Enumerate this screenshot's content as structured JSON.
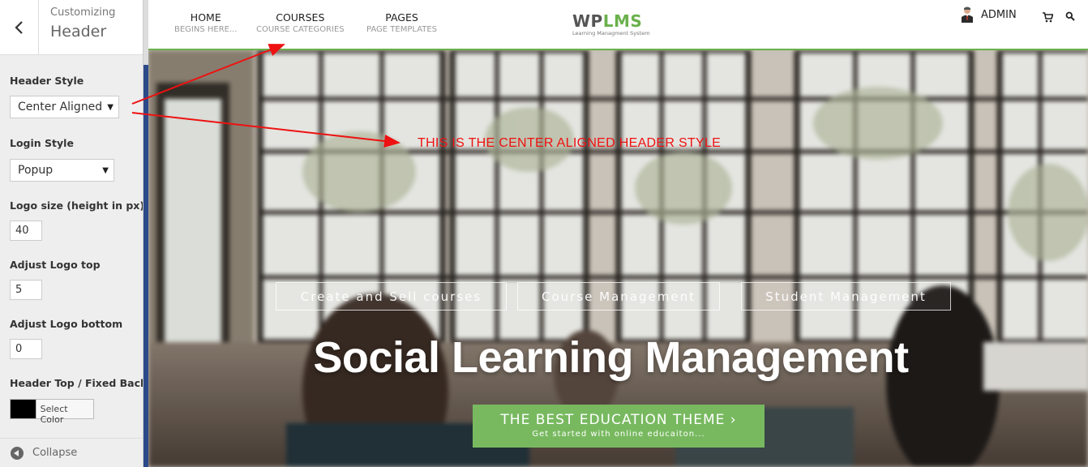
{
  "customizer": {
    "breadcrumb": "Customizing",
    "title": "Header",
    "controls": {
      "header_style": {
        "label": "Header Style",
        "value": "Center Aligned"
      },
      "login_style": {
        "label": "Login Style",
        "value": "Popup"
      },
      "logo_size": {
        "label": "Logo size (height in px)",
        "value": "40"
      },
      "logo_top": {
        "label": "Adjust Logo top",
        "value": "5"
      },
      "logo_bottom": {
        "label": "Adjust Logo bottom",
        "value": "0"
      },
      "header_bg": {
        "label": "Header Top / Fixed Background",
        "button": "Select Color",
        "color": "#000000"
      }
    },
    "collapse_label": "Collapse"
  },
  "site": {
    "nav": [
      {
        "label": "HOME",
        "sub": "BEGINS HERE..."
      },
      {
        "label": "COURSES",
        "sub": "COURSE CATEGORIES"
      },
      {
        "label": "PAGES",
        "sub": "PAGE TEMPLATES"
      }
    ],
    "logo": {
      "part1": "WP",
      "part2": "LMS",
      "tagline": "Learning Managment System"
    },
    "user_label": "ADMIN",
    "icons": [
      "cart-icon",
      "search-icon"
    ],
    "accent": "#6ab04c"
  },
  "hero": {
    "pills": [
      "Create and Sell courses",
      "Course Management",
      "Student Management"
    ],
    "title": "Social Learning Management",
    "cta": {
      "main": "THE BEST EDUCATION THEME ›",
      "sub": "Get started with online educaiton..."
    }
  },
  "annotation": {
    "text": "THIS IS THE CENTER ALIGNED HEADER STYLE",
    "color": "#ee1111"
  }
}
